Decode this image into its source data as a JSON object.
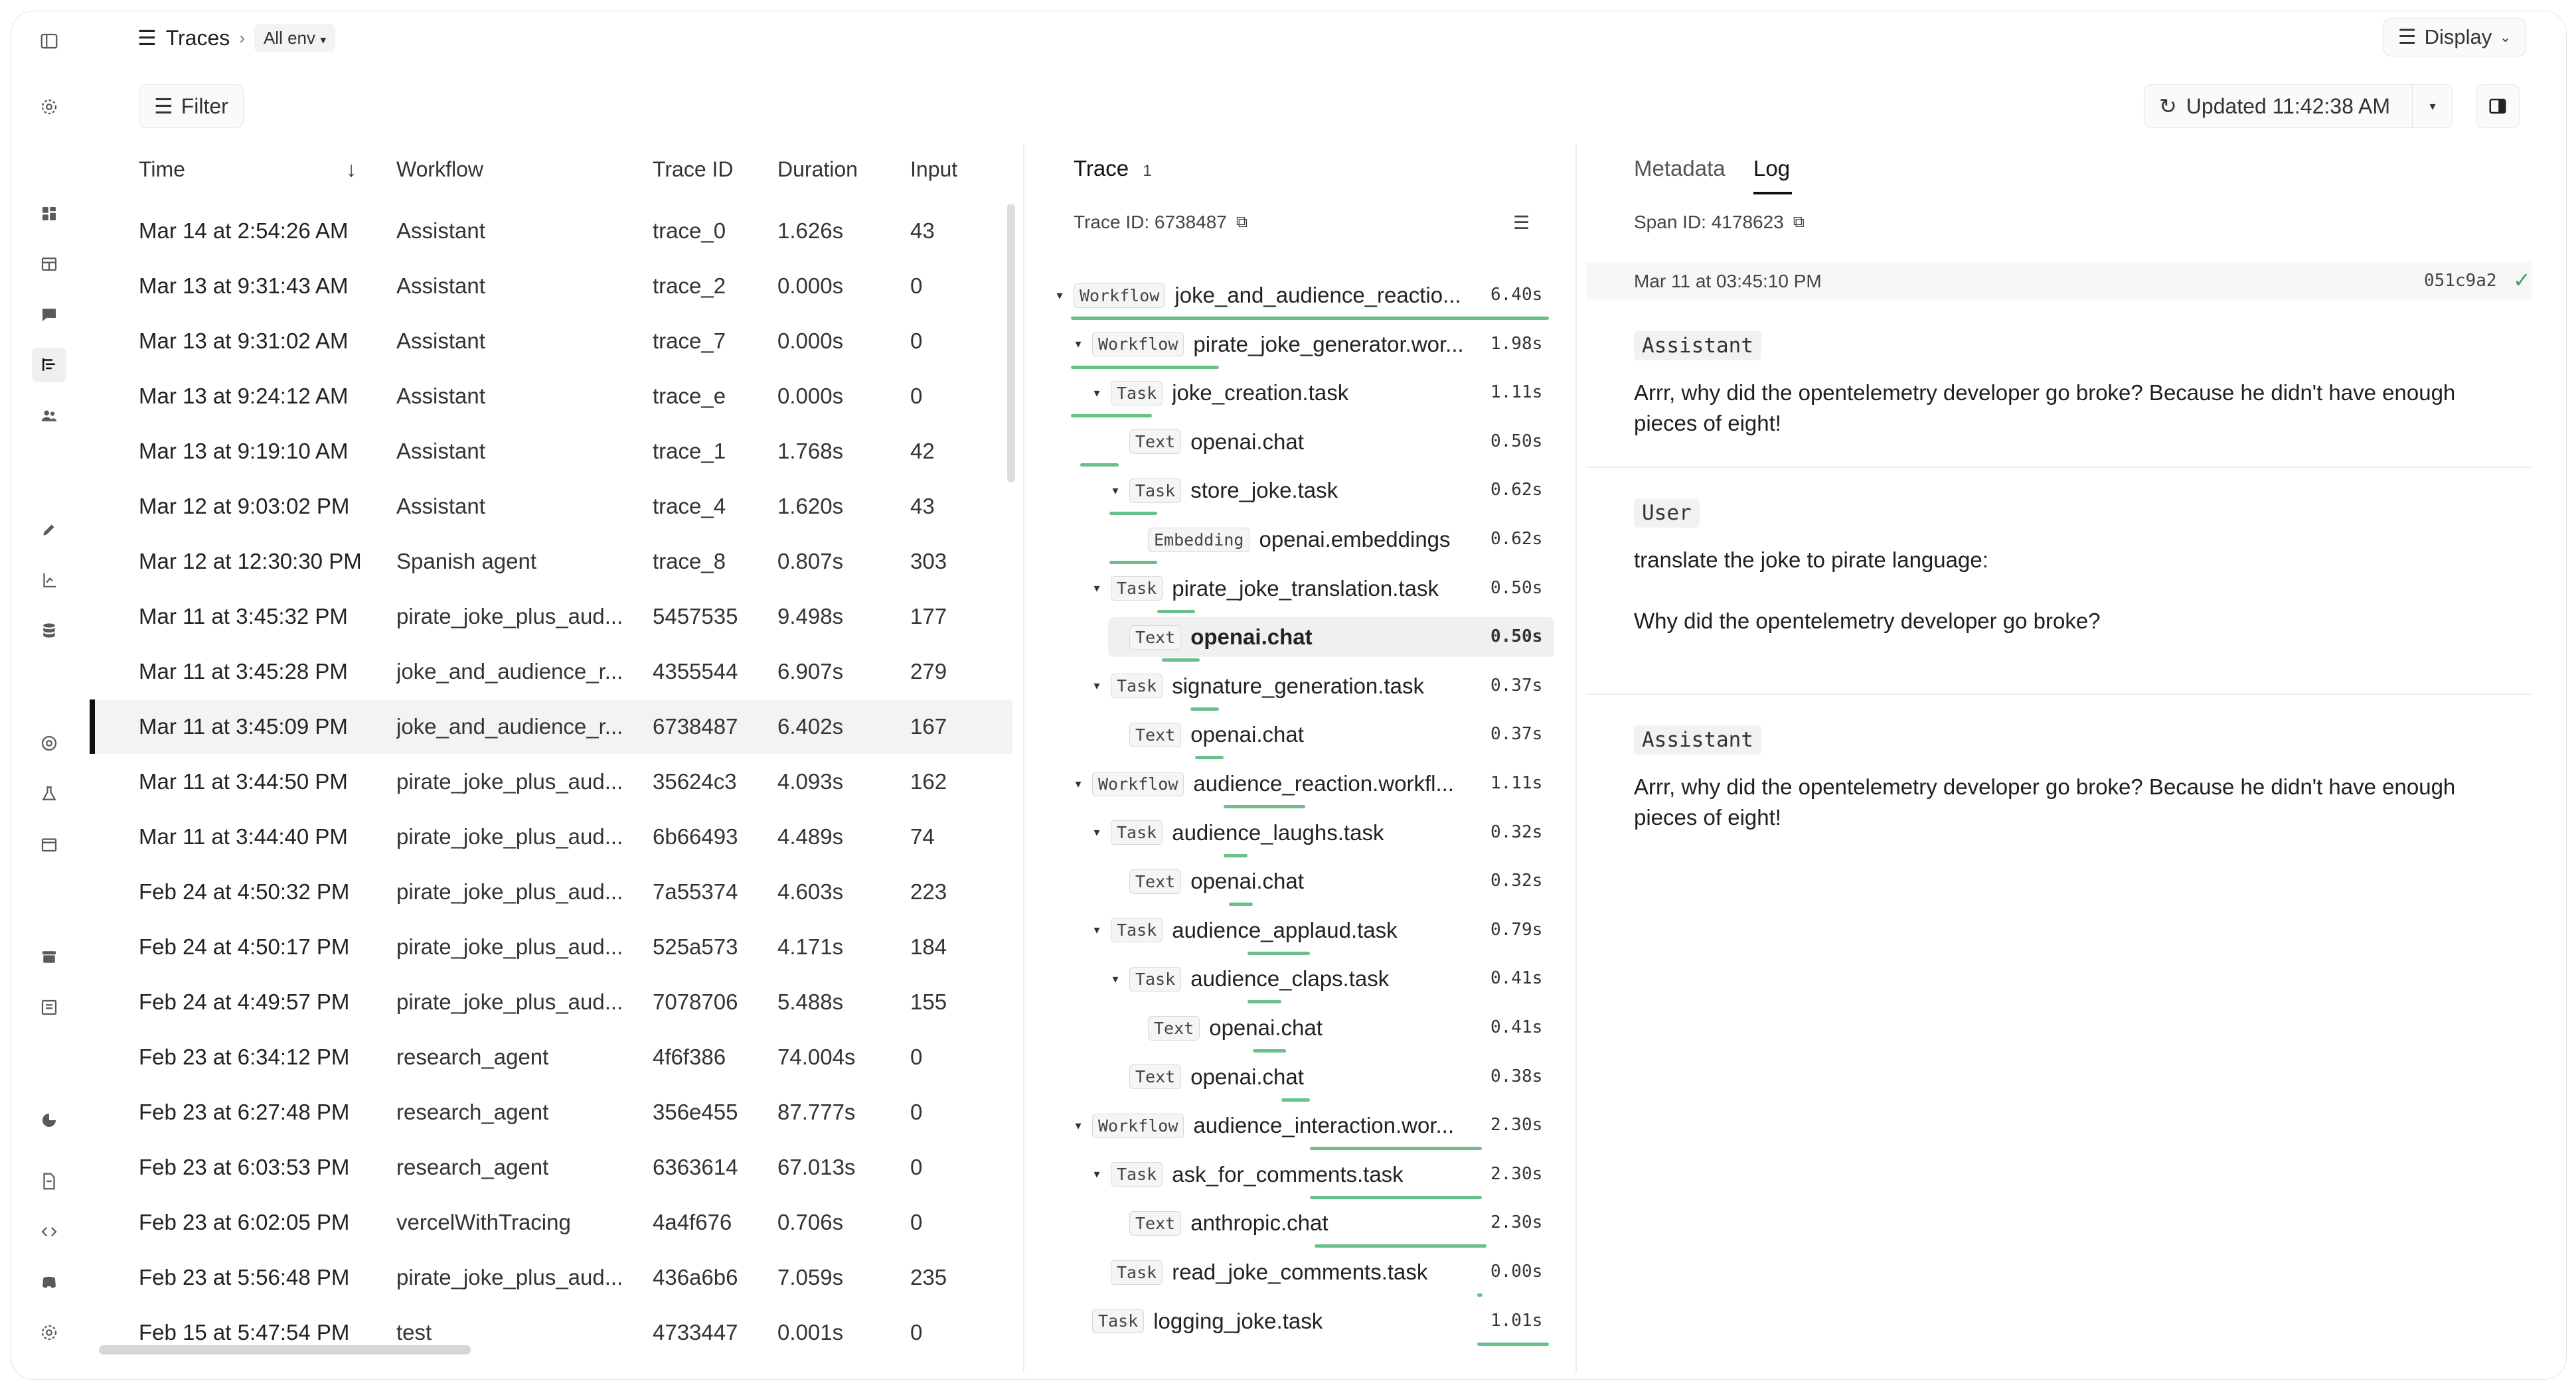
{
  "header": {
    "title": "Traces",
    "env": "All env",
    "display_label": "Display",
    "filter_label": "Filter",
    "updated_label": "Updated 11:42:38 AM"
  },
  "sidebar": {
    "icons": [
      "sidebar-toggle-icon",
      "settings-icon",
      "dashboard-icon",
      "table-icon",
      "chat-icon",
      "traces-icon",
      "users-icon",
      "pencil-icon",
      "flask-icon",
      "database-icon",
      "target-icon",
      "beaker-icon",
      "calendar-icon",
      "archive-icon",
      "list-icon",
      "pie-icon",
      "document-icon",
      "code-icon",
      "discord-icon",
      "gear-icon"
    ]
  },
  "table": {
    "columns": {
      "time": "Time",
      "workflow": "Workflow",
      "trace_id": "Trace ID",
      "duration": "Duration",
      "input": "Input"
    },
    "rows": [
      {
        "time": "Mar 14 at 2:54:26 AM",
        "workflow": "Assistant",
        "trace_id": "trace_0",
        "duration": "1.626s",
        "input": "43"
      },
      {
        "time": "Mar 13 at 9:31:43 AM",
        "workflow": "Assistant",
        "trace_id": "trace_2",
        "duration": "0.000s",
        "input": "0"
      },
      {
        "time": "Mar 13 at 9:31:02 AM",
        "workflow": "Assistant",
        "trace_id": "trace_7",
        "duration": "0.000s",
        "input": "0"
      },
      {
        "time": "Mar 13 at 9:24:12 AM",
        "workflow": "Assistant",
        "trace_id": "trace_e",
        "duration": "0.000s",
        "input": "0"
      },
      {
        "time": "Mar 13 at 9:19:10 AM",
        "workflow": "Assistant",
        "trace_id": "trace_1",
        "duration": "1.768s",
        "input": "42"
      },
      {
        "time": "Mar 12 at 9:03:02 PM",
        "workflow": "Assistant",
        "trace_id": "trace_4",
        "duration": "1.620s",
        "input": "43"
      },
      {
        "time": "Mar 12 at 12:30:30 PM",
        "workflow": "Spanish agent",
        "trace_id": "trace_8",
        "duration": "0.807s",
        "input": "303"
      },
      {
        "time": "Mar 11 at 3:45:32 PM",
        "workflow": "pirate_joke_plus_aud...",
        "trace_id": "5457535",
        "duration": "9.498s",
        "input": "177"
      },
      {
        "time": "Mar 11 at 3:45:28 PM",
        "workflow": "joke_and_audience_r...",
        "trace_id": "4355544",
        "duration": "6.907s",
        "input": "279"
      },
      {
        "time": "Mar 11 at 3:45:09 PM",
        "workflow": "joke_and_audience_r...",
        "trace_id": "6738487",
        "duration": "6.402s",
        "input": "167"
      },
      {
        "time": "Mar 11 at 3:44:50 PM",
        "workflow": "pirate_joke_plus_aud...",
        "trace_id": "35624c3",
        "duration": "4.093s",
        "input": "162"
      },
      {
        "time": "Mar 11 at 3:44:40 PM",
        "workflow": "pirate_joke_plus_aud...",
        "trace_id": "6b66493",
        "duration": "4.489s",
        "input": "74"
      },
      {
        "time": "Feb 24 at 4:50:32 PM",
        "workflow": "pirate_joke_plus_aud...",
        "trace_id": "7a55374",
        "duration": "4.603s",
        "input": "223"
      },
      {
        "time": "Feb 24 at 4:50:17 PM",
        "workflow": "pirate_joke_plus_aud...",
        "trace_id": "525a573",
        "duration": "4.171s",
        "input": "184"
      },
      {
        "time": "Feb 24 at 4:49:57 PM",
        "workflow": "pirate_joke_plus_aud...",
        "trace_id": "7078706",
        "duration": "5.488s",
        "input": "155"
      },
      {
        "time": "Feb 23 at 6:34:12 PM",
        "workflow": "research_agent",
        "trace_id": "4f6f386",
        "duration": "74.004s",
        "input": "0"
      },
      {
        "time": "Feb 23 at 6:27:48 PM",
        "workflow": "research_agent",
        "trace_id": "356e455",
        "duration": "87.777s",
        "input": "0"
      },
      {
        "time": "Feb 23 at 6:03:53 PM",
        "workflow": "research_agent",
        "trace_id": "6363614",
        "duration": "67.013s",
        "input": "0"
      },
      {
        "time": "Feb 23 at 6:02:05 PM",
        "workflow": "vercelWithTracing",
        "trace_id": "4a4f676",
        "duration": "0.706s",
        "input": "0"
      },
      {
        "time": "Feb 23 at 5:56:48 PM",
        "workflow": "pirate_joke_plus_aud...",
        "trace_id": "436a6b6",
        "duration": "7.059s",
        "input": "235"
      },
      {
        "time": "Feb 15 at 5:47:54 PM",
        "workflow": "test",
        "trace_id": "4733447",
        "duration": "0.001s",
        "input": "0"
      }
    ]
  },
  "trace": {
    "tab_label": "Trace",
    "tab_count": "1",
    "trace_id_label": "Trace ID: 6738487",
    "total": 6.4,
    "nodes": [
      {
        "type": "Workflow",
        "name": "joke_and_audience_reactio...",
        "dur": "6.40s",
        "depth": 0,
        "chev": true,
        "start": 0.0,
        "len": 1.0
      },
      {
        "type": "Workflow",
        "name": "pirate_joke_generator.wor...",
        "dur": "1.98s",
        "depth": 1,
        "chev": true,
        "start": 0.0,
        "len": 0.31
      },
      {
        "type": "Task",
        "name": "joke_creation.task",
        "dur": "1.11s",
        "depth": 2,
        "chev": true,
        "start": 0.0,
        "len": 0.17
      },
      {
        "type": "Text",
        "name": "openai.chat",
        "dur": "0.50s",
        "depth": 3,
        "chev": false,
        "start": 0.02,
        "len": 0.08
      },
      {
        "type": "Task",
        "name": "store_joke.task",
        "dur": "0.62s",
        "depth": 3,
        "chev": true,
        "start": 0.08,
        "len": 0.1
      },
      {
        "type": "Embedding",
        "name": "openai.embeddings",
        "dur": "0.62s",
        "depth": 4,
        "chev": false,
        "start": 0.08,
        "len": 0.1
      },
      {
        "type": "Task",
        "name": "pirate_joke_translation.task",
        "dur": "0.50s",
        "depth": 2,
        "chev": true,
        "start": 0.18,
        "len": 0.08
      },
      {
        "type": "Text",
        "name": "openai.chat",
        "dur": "0.50s",
        "depth": 3,
        "chev": false,
        "start": 0.19,
        "len": 0.08,
        "selected": true
      },
      {
        "type": "Task",
        "name": "signature_generation.task",
        "dur": "0.37s",
        "depth": 2,
        "chev": true,
        "start": 0.25,
        "len": 0.06
      },
      {
        "type": "Text",
        "name": "openai.chat",
        "dur": "0.37s",
        "depth": 3,
        "chev": false,
        "start": 0.26,
        "len": 0.06
      },
      {
        "type": "Workflow",
        "name": "audience_reaction.workfl...",
        "dur": "1.11s",
        "depth": 1,
        "chev": true,
        "start": 0.32,
        "len": 0.17
      },
      {
        "type": "Task",
        "name": "audience_laughs.task",
        "dur": "0.32s",
        "depth": 2,
        "chev": true,
        "start": 0.32,
        "len": 0.05
      },
      {
        "type": "Text",
        "name": "openai.chat",
        "dur": "0.32s",
        "depth": 3,
        "chev": false,
        "start": 0.33,
        "len": 0.05
      },
      {
        "type": "Task",
        "name": "audience_applaud.task",
        "dur": "0.79s",
        "depth": 2,
        "chev": true,
        "start": 0.37,
        "len": 0.13
      },
      {
        "type": "Task",
        "name": "audience_claps.task",
        "dur": "0.41s",
        "depth": 3,
        "chev": true,
        "start": 0.37,
        "len": 0.07
      },
      {
        "type": "Text",
        "name": "openai.chat",
        "dur": "0.41s",
        "depth": 4,
        "chev": false,
        "start": 0.38,
        "len": 0.07
      },
      {
        "type": "Text",
        "name": "openai.chat",
        "dur": "0.38s",
        "depth": 3,
        "chev": false,
        "start": 0.44,
        "len": 0.06
      },
      {
        "type": "Workflow",
        "name": "audience_interaction.wor...",
        "dur": "2.30s",
        "depth": 1,
        "chev": true,
        "start": 0.5,
        "len": 0.36
      },
      {
        "type": "Task",
        "name": "ask_for_comments.task",
        "dur": "2.30s",
        "depth": 2,
        "chev": true,
        "start": 0.5,
        "len": 0.36
      },
      {
        "type": "Text",
        "name": "anthropic.chat",
        "dur": "2.30s",
        "depth": 3,
        "chev": false,
        "start": 0.51,
        "len": 0.36
      },
      {
        "type": "Task",
        "name": "read_joke_comments.task",
        "dur": "0.00s",
        "depth": 2,
        "chev": false,
        "start": 0.85,
        "len": 0.01
      },
      {
        "type": "Task",
        "name": "logging_joke.task",
        "dur": "1.01s",
        "depth": 1,
        "chev": false,
        "start": 0.85,
        "len": 0.15
      }
    ]
  },
  "detail": {
    "tabs": [
      "Metadata",
      "Log"
    ],
    "span_id_label": "Span ID: 4178623",
    "timestamp": "Mar 11 at 03:45:10 PM",
    "hash": "051c9a2",
    "messages": [
      {
        "role": "Assistant",
        "text": "Arrr, why did the opentelemetry developer go broke? Because he didn't have enough pieces of eight!"
      },
      {
        "role": "User",
        "text": "translate the joke to pirate language:",
        "text2": "Why did the opentelemetry developer go broke?"
      },
      {
        "role": "Assistant",
        "text": "Arrr, why did the opentelemetry developer go broke? Because he didn't have enough pieces of eight!"
      }
    ]
  },
  "colors": {
    "accent": "#6abf8a",
    "selected_row": "#f3f3f3"
  }
}
